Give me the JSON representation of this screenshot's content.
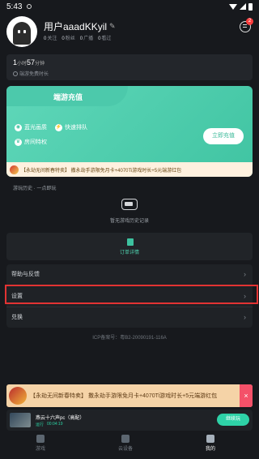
{
  "status": {
    "time": "5:43"
  },
  "profile": {
    "name": "用户aaadKKyil",
    "stats": [
      {
        "count": "0",
        "label": "关注"
      },
      {
        "count": "0",
        "label": "粉丝"
      },
      {
        "count": "0",
        "label": "广播"
      },
      {
        "count": "0",
        "label": "看过"
      }
    ],
    "message_badge": "2"
  },
  "playtime": {
    "hours": "1",
    "hours_unit": "小时",
    "minutes": "57",
    "minutes_unit": "分钟",
    "subtitle": "端游免费时长"
  },
  "vip": {
    "title": "端游充值",
    "benefits": [
      "蓝光画质",
      "快速排队",
      "房间特权"
    ],
    "button": "立即充值",
    "promo": "【永劫无间新春特卖】 撒永劫手游限免月卡+4070Ti游戏时长+5元端游红包"
  },
  "history": {
    "title": "游玩历史 · 一点即玩",
    "empty": "暂无游戏历史记录"
  },
  "orders": {
    "label": "订单详情"
  },
  "menu": {
    "help": "帮助与反馈",
    "settings": "设置",
    "redeem": "兑换"
  },
  "icp": "ICP备案号：粤B2-20090191-116A",
  "promo_banner": {
    "text": "【永劫无间新春特卖】 撒永劫手游限免月卡+4070Ti游戏时长+5元端游红包",
    "close": "×"
  },
  "playing": {
    "title": "燕云十六声pc（高配）",
    "status": "运行",
    "elapsed": "00:04:19",
    "button": "继续玩"
  },
  "tabs": [
    "游戏",
    "云设备",
    "我的"
  ]
}
